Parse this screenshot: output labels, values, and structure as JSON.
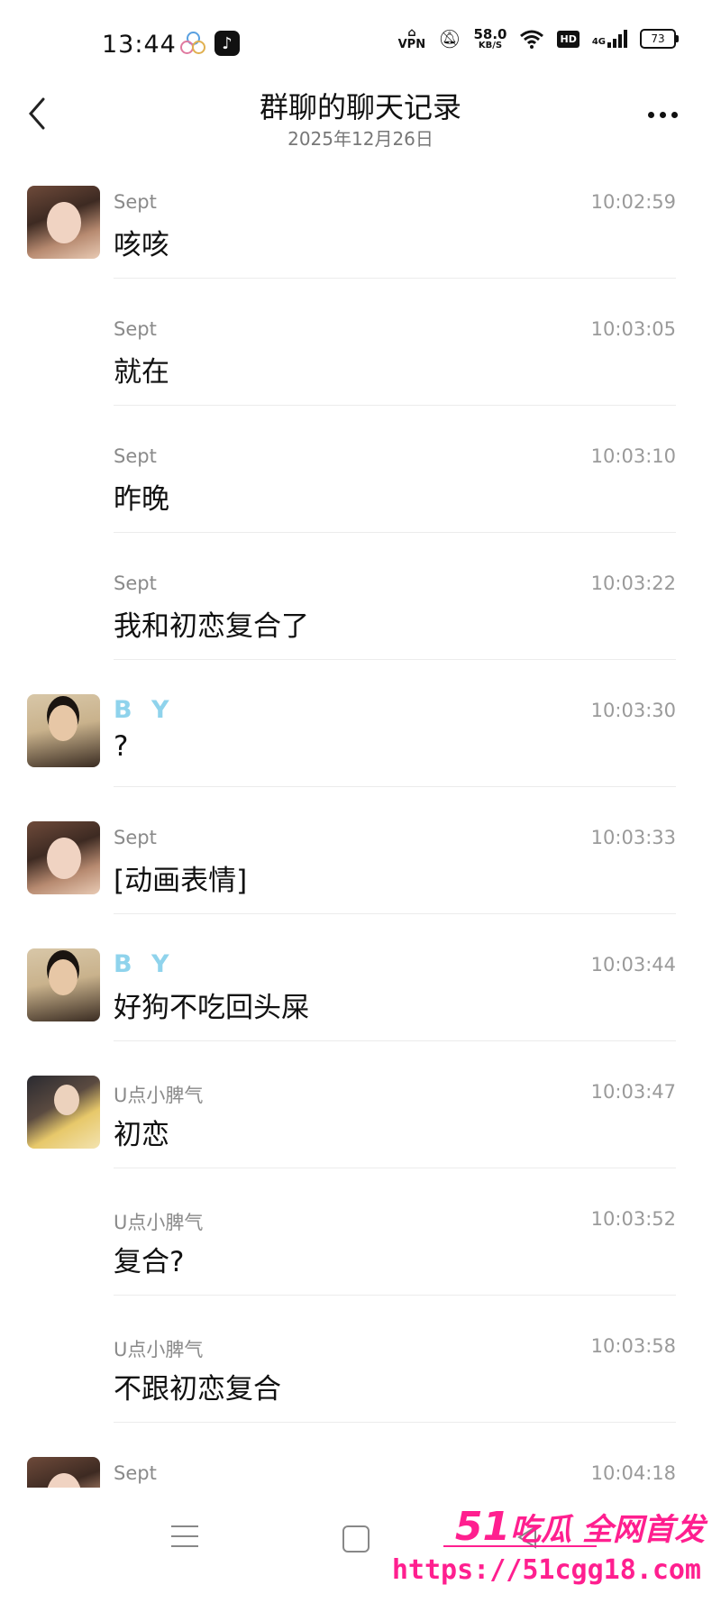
{
  "status_bar": {
    "time": "13:44",
    "vpn": "VPN",
    "speed_value": "58.0",
    "speed_unit": "KB/S",
    "hd": "HD",
    "network": "4G",
    "battery": "73"
  },
  "header": {
    "title": "群聊的聊天记录",
    "date": "2025年12月26日"
  },
  "messages": [
    {
      "sender": "Sept",
      "time": "10:02:59",
      "text": "咳咳",
      "avatar": "sept"
    },
    {
      "sender": "Sept",
      "time": "10:03:05",
      "text": "就在",
      "avatar": ""
    },
    {
      "sender": "Sept",
      "time": "10:03:10",
      "text": "昨晚",
      "avatar": ""
    },
    {
      "sender": "Sept",
      "time": "10:03:22",
      "text": "我和初恋复合了",
      "avatar": ""
    },
    {
      "sender": "B Y",
      "time": "10:03:30",
      "text": "?",
      "avatar": "by"
    },
    {
      "sender": "Sept",
      "time": "10:03:33",
      "text": "[动画表情]",
      "avatar": "sept"
    },
    {
      "sender": "B Y",
      "time": "10:03:44",
      "text": "好狗不吃回头屎",
      "avatar": "by"
    },
    {
      "sender": "U点小脾气",
      "time": "10:03:47",
      "text": "初恋",
      "avatar": "u"
    },
    {
      "sender": "U点小脾气",
      "time": "10:03:52",
      "text": "复合?",
      "avatar": ""
    },
    {
      "sender": "U点小脾气",
      "time": "10:03:58",
      "text": "不跟初恋复合",
      "avatar": ""
    },
    {
      "sender": "Sept",
      "time": "10:04:18",
      "text": "",
      "avatar": "sept"
    }
  ],
  "watermark": {
    "brand_num": "51",
    "brand_text": "吃瓜 全网首发",
    "url": "https://51cgg18.com"
  }
}
